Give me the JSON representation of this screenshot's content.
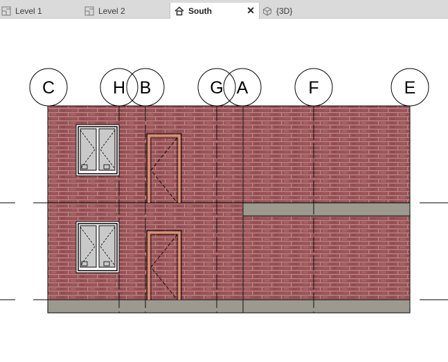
{
  "tabs": [
    {
      "label": "Level 1",
      "icon": "floor-plan-icon",
      "active": false
    },
    {
      "label": "Level 2",
      "icon": "floor-plan-icon",
      "active": false
    },
    {
      "label": "South",
      "icon": "elevation-icon",
      "active": true
    },
    {
      "label": "{3D}",
      "icon": "3d-view-icon",
      "active": false
    }
  ],
  "close_glyph": "✕",
  "grids": {
    "c": "C",
    "h": "H",
    "b": "B",
    "g": "G",
    "a": "A",
    "f": "F",
    "e": "E"
  },
  "colors": {
    "brick": "#9a5258",
    "mortar": "#b98a86",
    "foundation": "#9c998e",
    "door_frame": "#e09272"
  }
}
